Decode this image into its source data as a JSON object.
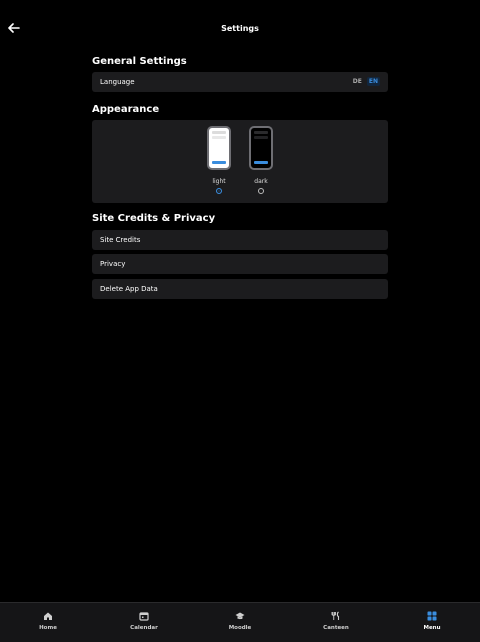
{
  "header": {
    "title": "Settings",
    "back_icon": "arrow-left-icon"
  },
  "general": {
    "heading": "General Settings",
    "language_label": "Language",
    "lang_options": [
      "DE",
      "EN"
    ],
    "lang_selected": "EN"
  },
  "appearance": {
    "heading": "Appearance",
    "options": [
      {
        "label": "light",
        "selected": true
      },
      {
        "label": "dark",
        "selected": false
      }
    ]
  },
  "credits": {
    "heading": "Site Credits & Privacy",
    "items": [
      "Site Credits",
      "Privacy",
      "Delete App Data"
    ]
  },
  "tabbar": {
    "items": [
      {
        "label": "Home",
        "icon": "home-icon"
      },
      {
        "label": "Calendar",
        "icon": "calendar-icon"
      },
      {
        "label": "Moodle",
        "icon": "graduation-cap-icon"
      },
      {
        "label": "Canteen",
        "icon": "fork-knife-icon"
      },
      {
        "label": "Menu",
        "icon": "grid-icon"
      }
    ],
    "active": "Menu",
    "accent": "#3a8dde"
  }
}
